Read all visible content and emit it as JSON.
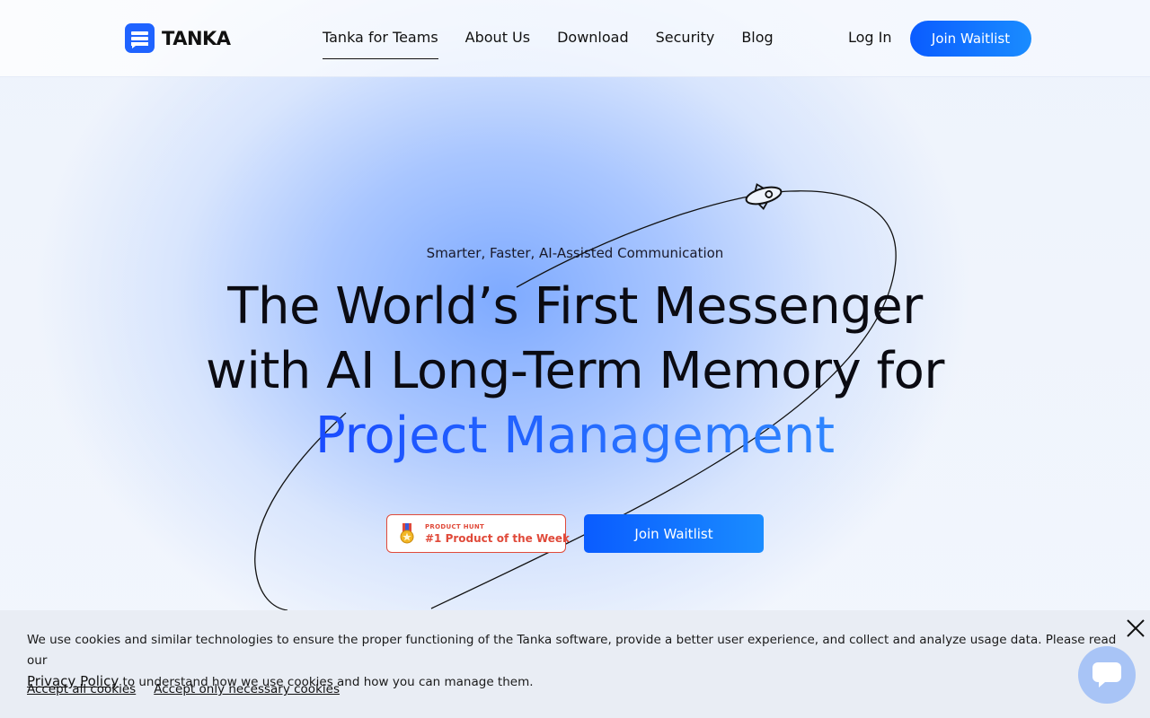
{
  "brand": {
    "name": "TANKA"
  },
  "nav": {
    "items": [
      {
        "label": "Tanka for Teams",
        "active": true
      },
      {
        "label": "About Us"
      },
      {
        "label": "Download"
      },
      {
        "label": "Security"
      },
      {
        "label": "Blog"
      }
    ],
    "login_label": "Log In",
    "join_label": "Join Waitlist"
  },
  "hero": {
    "tagline": "Smarter, Faster, AI-Assisted Communication",
    "headline_line1": "The World’s First Messenger",
    "headline_line2": "with AI Long-Term Memory for",
    "headline_accent": "Project Management",
    "badge_small": "PRODUCT HUNT",
    "badge_big": "#1 Product of the Week",
    "join_label": "Join Waitlist"
  },
  "cookie": {
    "message_part1": "We use cookies and similar technologies to ensure the proper functioning of the Tanka software, provide a better user experience, and collect and analyze usage data. Please read our",
    "policy_link": "Privacy Policy",
    "message_part2": " to understand how we use cookies and how you can manage them.",
    "accept_all": "Accept all cookies",
    "accept_necessary": "Accept only necessary cookies"
  },
  "colors": {
    "accent": "#0a5cff",
    "badge_red": "#e04a3a",
    "cookie_bg": "#e9edf4"
  },
  "icons": {
    "logo": "chat-bubble-icon",
    "orbit_rocket": "rocket-icon",
    "medal": "medal-icon",
    "close": "close-icon",
    "chat": "chat-icon"
  }
}
